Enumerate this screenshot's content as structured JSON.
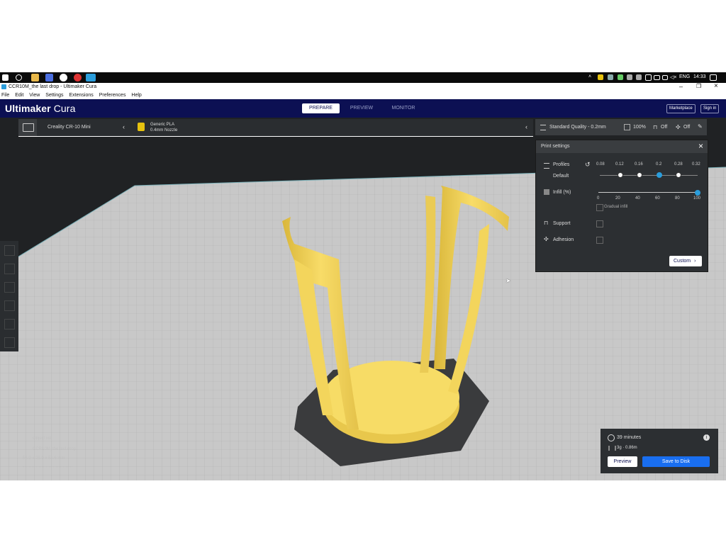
{
  "taskbar": {
    "tray": {
      "lang": "ENG",
      "time": "14:33"
    }
  },
  "window": {
    "title": "CCR10M_the last drop - Ultimaker Cura",
    "menu": [
      "File",
      "Edit",
      "View",
      "Settings",
      "Extensions",
      "Preferences",
      "Help"
    ]
  },
  "header": {
    "logo_strong": "Ultimaker",
    "logo_light": " Cura",
    "stages": [
      "PREPARE",
      "PREVIEW",
      "MONITOR"
    ],
    "active_stage": "PREPARE",
    "marketplace": "Marketplace",
    "signin": "Sign in"
  },
  "toolbar": {
    "printer": "Creality CR-10 Mini",
    "material": "Generic PLA",
    "nozzle": "0.4mm Nozzle",
    "quality": "Standard Quality - 0.2mm",
    "infill": "100%",
    "support": "Off",
    "adhesion": "Off"
  },
  "print_settings": {
    "title": "Print settings",
    "profiles_label": "Profiles",
    "profile_name": "Default",
    "layer_heights": [
      "0.08",
      "0.12",
      "0.16",
      "0.2",
      "0.28",
      "0.32"
    ],
    "selected_layer_height": "0.2",
    "infill_label": "Infill (%)",
    "infill_ticks": [
      "0",
      "20",
      "40",
      "60",
      "80",
      "100"
    ],
    "infill_value": 100,
    "gradual_infill": "Gradual infill",
    "support_label": "Support",
    "adhesion_label": "Adhesion",
    "custom_button": "Custom"
  },
  "object_info": {
    "objects": "Object list",
    "file": "CCR10M_the last drop",
    "dims": "56.0 x 25.0 x 58.6 mm"
  },
  "action_panel": {
    "time": "39 minutes",
    "material_usage": "3g · 0.86m",
    "preview_button": "Preview",
    "save_button": "Save to Disk"
  },
  "colors": {
    "header_bg": "#0c1053",
    "accent_blue": "#2b9ddb",
    "save_blue": "#196ef0",
    "model_yellow": "#f6d75a",
    "toolbar_bg": "#2a2d30"
  }
}
